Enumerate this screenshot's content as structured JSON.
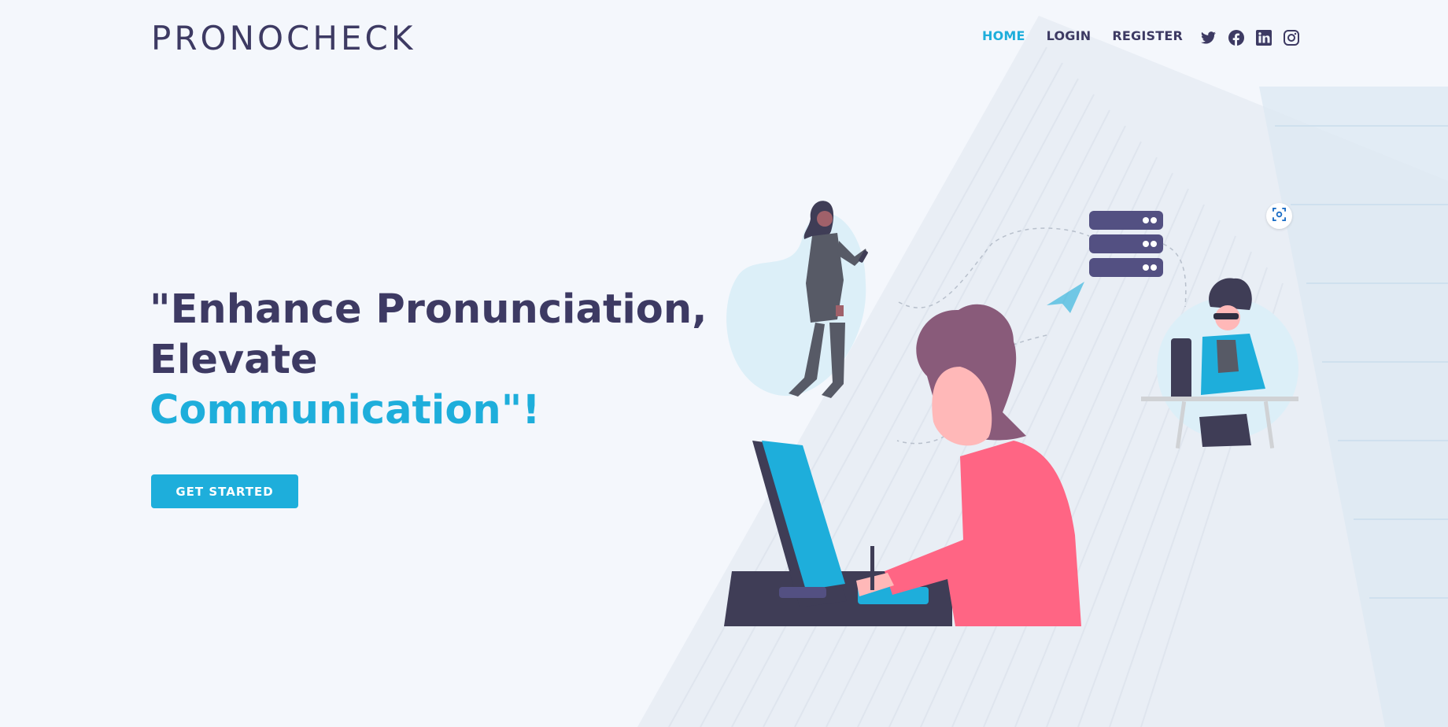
{
  "header": {
    "logo": "PRONOCHECK",
    "nav": [
      {
        "label": "HOME",
        "active": true
      },
      {
        "label": "LOGIN",
        "active": false
      },
      {
        "label": "REGISTER",
        "active": false
      }
    ],
    "social_icons": [
      "twitter-icon",
      "facebook-icon",
      "linkedin-icon",
      "instagram-icon"
    ]
  },
  "hero": {
    "title_line1": "\"Enhance Pronunciation,",
    "title_line2": "Elevate",
    "title_line3": "Communication\"!",
    "cta_label": "GET STARTED"
  },
  "colors": {
    "accent": "#1eaedb",
    "primary_text": "#3d3a63",
    "background": "#f4f7fc",
    "illustration_pink": "#ff6584",
    "illustration_dark": "#3f3d56"
  }
}
